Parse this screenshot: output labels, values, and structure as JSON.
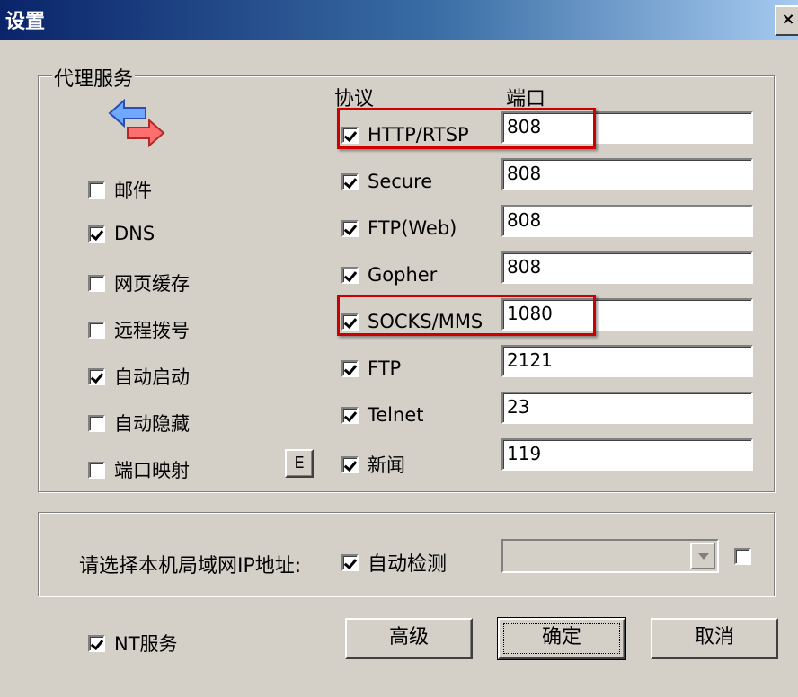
{
  "window": {
    "title": "设置",
    "close_label": "×"
  },
  "proxy_group": {
    "label": "代理服务"
  },
  "columns": {
    "protocol": "协议",
    "port": "端口"
  },
  "services": [
    {
      "label": "邮件",
      "checked": false
    },
    {
      "label": "DNS",
      "checked": true
    },
    {
      "label": "网页缓存",
      "checked": false
    },
    {
      "label": "远程拨号",
      "checked": false
    },
    {
      "label": "自动启动",
      "checked": true
    },
    {
      "label": "自动隐藏",
      "checked": false
    },
    {
      "label": "端口映射",
      "checked": false
    }
  ],
  "port_map_button": "E",
  "protocols": [
    {
      "label": "HTTP/RTSP",
      "checked": true,
      "port": "808",
      "highlighted": true
    },
    {
      "label": "Secure",
      "checked": true,
      "port": "808",
      "highlighted": false
    },
    {
      "label": "FTP(Web)",
      "checked": true,
      "port": "808",
      "highlighted": false
    },
    {
      "label": "Gopher",
      "checked": true,
      "port": "808",
      "highlighted": false
    },
    {
      "label": "SOCKS/MMS",
      "checked": true,
      "port": "1080",
      "highlighted": true
    },
    {
      "label": "FTP",
      "checked": true,
      "port": "2121",
      "highlighted": false
    },
    {
      "label": "Telnet",
      "checked": true,
      "port": "23",
      "highlighted": false
    },
    {
      "label": "新闻",
      "checked": true,
      "port": "119",
      "highlighted": false
    }
  ],
  "lan_ip": {
    "label": "请选择本机局域网IP地址:",
    "auto_detect_label": "自动检测",
    "auto_detect_checked": true,
    "extra_checked": false
  },
  "nt_service": {
    "label": "NT服务",
    "checked": true
  },
  "buttons": {
    "advanced": "高级",
    "ok": "确定",
    "cancel": "取消"
  },
  "colors": {
    "highlight_box": "#cc0000",
    "title_bar_start": "#0a246a"
  }
}
